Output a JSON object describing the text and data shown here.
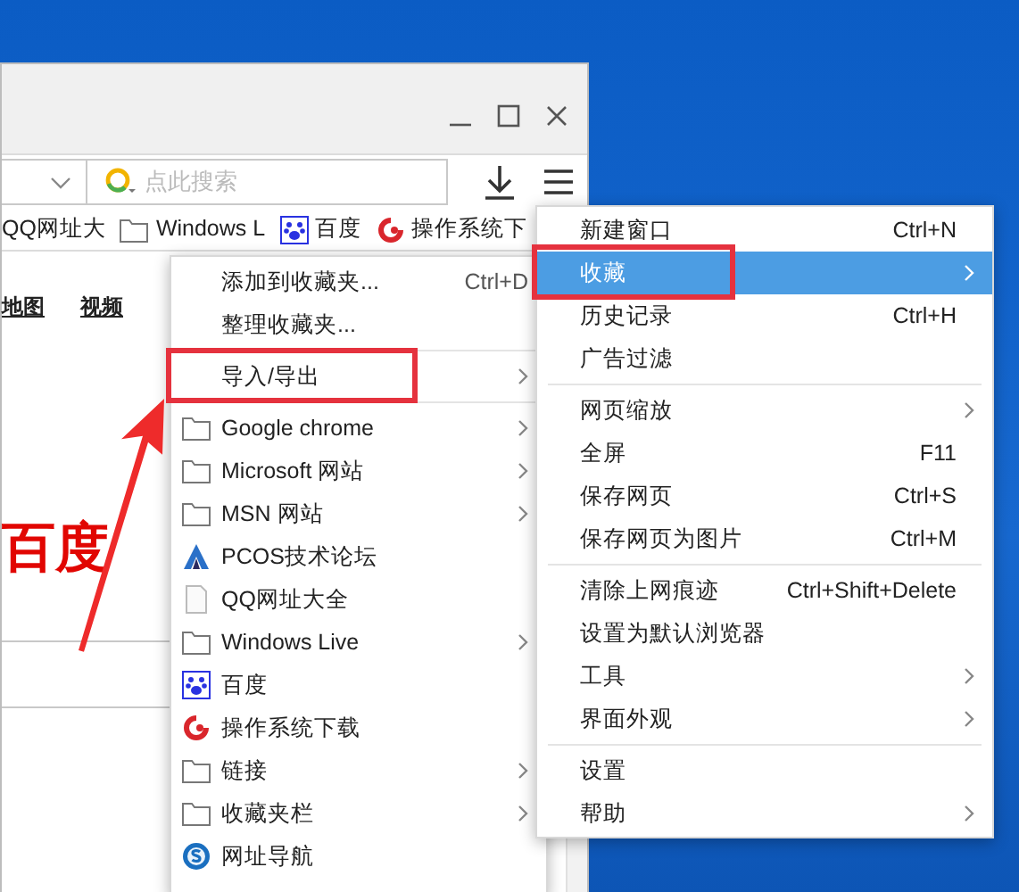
{
  "search": {
    "placeholder": "点此搜索"
  },
  "bookmarks_bar": [
    {
      "kind": "plain",
      "label": "QQ网址大"
    },
    {
      "kind": "folder",
      "label": "Windows L"
    },
    {
      "kind": "site",
      "label": "百度"
    },
    {
      "kind": "site",
      "label": "操作系统下"
    }
  ],
  "page": {
    "nav_links": [
      "地图",
      "视频"
    ],
    "logo_text": "百度"
  },
  "favorites_menu": [
    {
      "kind": "command",
      "label": "添加到收藏夹...",
      "shortcut": "Ctrl+D",
      "submenu": false,
      "highlighted": false
    },
    {
      "kind": "command",
      "label": "整理收藏夹...",
      "submenu": false,
      "highlighted": false
    },
    {
      "kind": "separator"
    },
    {
      "kind": "command",
      "label": "导入/导出",
      "submenu": true,
      "highlighted": true
    },
    {
      "kind": "separator"
    },
    {
      "kind": "folder",
      "label": "Google chrome",
      "submenu": true,
      "highlighted": false
    },
    {
      "kind": "folder",
      "label": "Microsoft 网站",
      "submenu": true,
      "highlighted": false
    },
    {
      "kind": "folder",
      "label": "MSN 网站",
      "submenu": true,
      "highlighted": false
    },
    {
      "kind": "site",
      "label": "PCOS技术论坛",
      "submenu": false,
      "highlighted": false
    },
    {
      "kind": "site",
      "label": "QQ网址大全",
      "submenu": false,
      "highlighted": false
    },
    {
      "kind": "folder",
      "label": "Windows Live",
      "submenu": true,
      "highlighted": false
    },
    {
      "kind": "site",
      "label": "百度",
      "submenu": false,
      "highlighted": false
    },
    {
      "kind": "site",
      "label": "操作系统下载",
      "submenu": false,
      "highlighted": false
    },
    {
      "kind": "folder",
      "label": "链接",
      "submenu": true,
      "highlighted": false
    },
    {
      "kind": "folder",
      "label": "收藏夹栏",
      "submenu": true,
      "highlighted": false
    },
    {
      "kind": "site",
      "label": "网址导航",
      "submenu": false,
      "highlighted": false
    }
  ],
  "main_menu": [
    {
      "kind": "command",
      "label": "新建窗口",
      "shortcut": "Ctrl+N",
      "submenu": false,
      "selected": false,
      "highlighted": false
    },
    {
      "kind": "command",
      "label": "收藏",
      "submenu": true,
      "selected": true,
      "highlighted": true
    },
    {
      "kind": "command",
      "label": "历史记录",
      "shortcut": "Ctrl+H",
      "submenu": false,
      "selected": false,
      "highlighted": false
    },
    {
      "kind": "command",
      "label": "广告过滤",
      "submenu": false,
      "selected": false,
      "highlighted": false
    },
    {
      "kind": "separator"
    },
    {
      "kind": "command",
      "label": "网页缩放",
      "submenu": true,
      "selected": false,
      "highlighted": false
    },
    {
      "kind": "command",
      "label": "全屏",
      "shortcut": "F11",
      "submenu": false,
      "selected": false,
      "highlighted": false
    },
    {
      "kind": "command",
      "label": "保存网页",
      "shortcut": "Ctrl+S",
      "submenu": false,
      "selected": false,
      "highlighted": false
    },
    {
      "kind": "command",
      "label": "保存网页为图片",
      "shortcut": "Ctrl+M",
      "submenu": false,
      "selected": false,
      "highlighted": false
    },
    {
      "kind": "separator"
    },
    {
      "kind": "command",
      "label": "清除上网痕迹",
      "shortcut": "Ctrl+Shift+Delete",
      "submenu": false,
      "selected": false,
      "highlighted": false
    },
    {
      "kind": "command",
      "label": "设置为默认浏览器",
      "submenu": false,
      "selected": false,
      "highlighted": false
    },
    {
      "kind": "command",
      "label": "工具",
      "submenu": true,
      "selected": false,
      "highlighted": false
    },
    {
      "kind": "command",
      "label": "界面外观",
      "submenu": true,
      "selected": false,
      "highlighted": false
    },
    {
      "kind": "separator"
    },
    {
      "kind": "command",
      "label": "设置",
      "submenu": false,
      "selected": false,
      "highlighted": false
    },
    {
      "kind": "command",
      "label": "帮助",
      "submenu": true,
      "selected": false,
      "highlighted": false
    }
  ]
}
